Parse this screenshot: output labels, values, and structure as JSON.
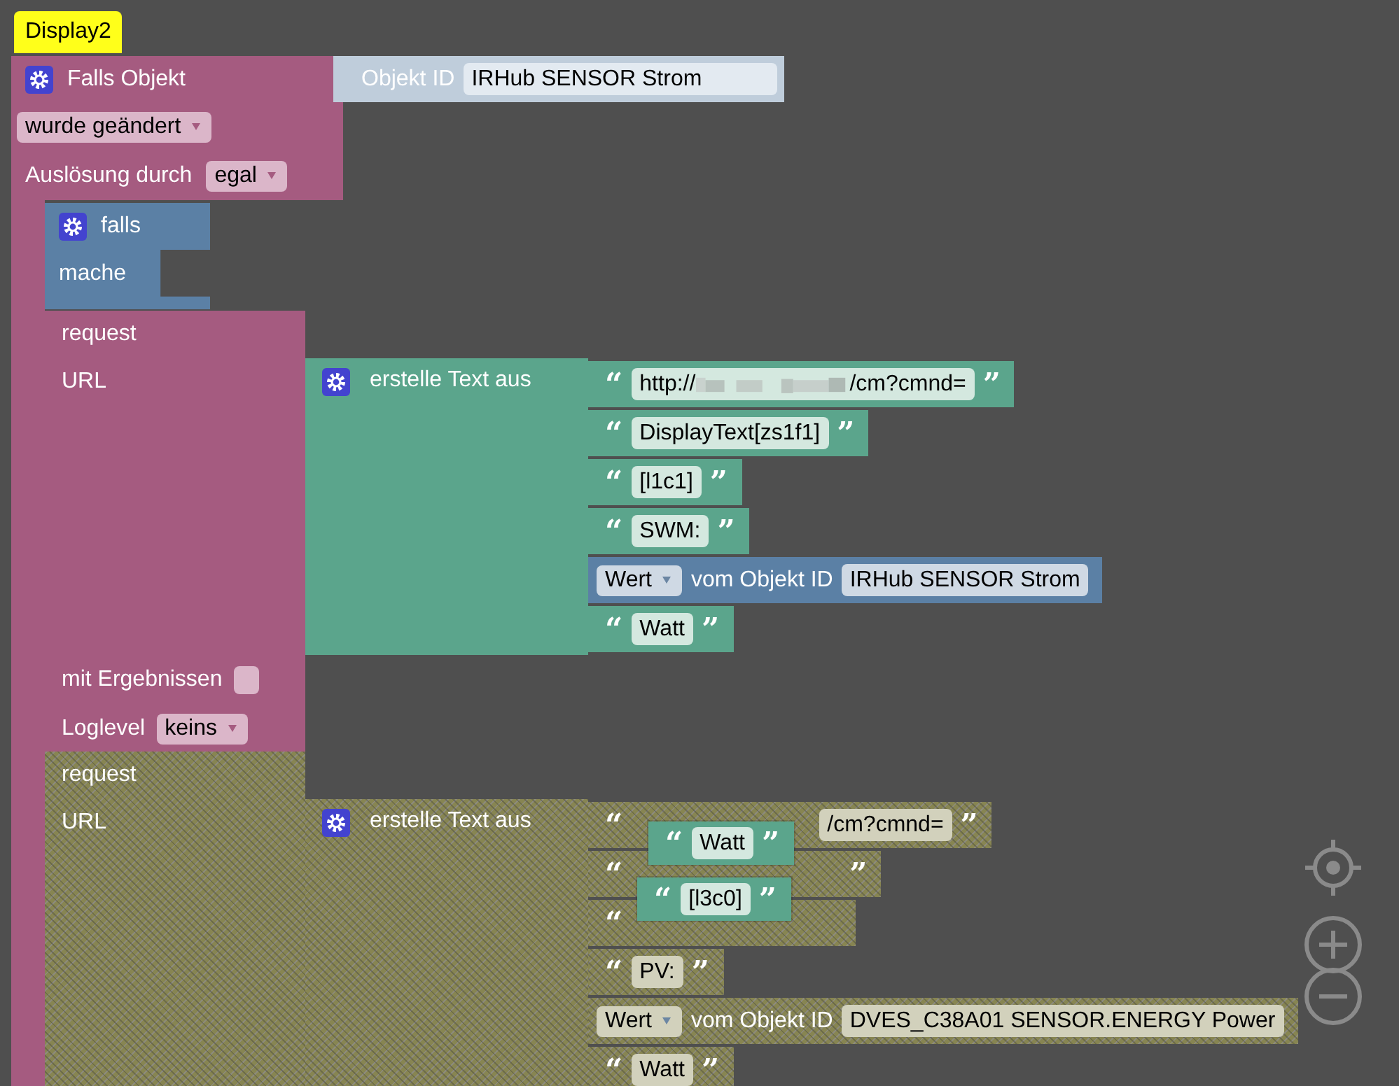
{
  "comment": {
    "text": "Display2"
  },
  "trigger": {
    "title": "Falls Objekt",
    "object_label": "Objekt ID",
    "object_value": "IRHub SENSOR Strom",
    "event": "wurde geändert",
    "trigger_label": "Auslösung durch",
    "trigger_value": "egal"
  },
  "if_block": {
    "if_label": "falls",
    "do_label": "mache"
  },
  "requests": [
    {
      "disabled": false,
      "title": "request",
      "url_label": "URL",
      "join_label": "erstelle Text aus",
      "results_label": "mit Ergebnissen",
      "results_checked": false,
      "loglevel_label": "Loglevel",
      "loglevel_value": "keins",
      "parts": [
        {
          "kind": "text",
          "open": "“",
          "value": "http://",
          "redacted": true,
          "tail": "/cm?cmnd=",
          "close": "”"
        },
        {
          "kind": "text",
          "open": "“",
          "value": "DisplayText[zs1f1]",
          "close": "”"
        },
        {
          "kind": "text",
          "open": "“",
          "value": "[l1c1]",
          "close": "”"
        },
        {
          "kind": "text",
          "open": "“",
          "value": "SWM:",
          "close": "”"
        },
        {
          "kind": "object",
          "mode": "Wert",
          "label": "vom Objekt ID",
          "value": "IRHub SENSOR Strom"
        },
        {
          "kind": "text",
          "open": "“",
          "value": "Watt",
          "close": "”"
        }
      ]
    },
    {
      "disabled": true,
      "title": "request",
      "url_label": "URL",
      "join_label": "erstelle Text aus",
      "parts": [
        {
          "kind": "text",
          "open": "“",
          "tail": "/cm?cmnd=",
          "close": "”"
        },
        {
          "kind": "text",
          "open": "“",
          "close": "”"
        },
        {
          "kind": "text",
          "open": "“"
        },
        {
          "kind": "text",
          "open": "“",
          "value": "PV:",
          "close": "”"
        },
        {
          "kind": "object",
          "mode": "Wert",
          "label": "vom Objekt ID",
          "value": "DVES_C38A01 SENSOR.ENERGY  Power"
        },
        {
          "kind": "text",
          "open": "“",
          "value": "Watt",
          "close": "”"
        }
      ]
    }
  ],
  "floating_blocks": [
    {
      "open": "“",
      "value": "Watt",
      "close": "”"
    },
    {
      "open": "“",
      "value": "[l3c0]",
      "close": "”"
    }
  ]
}
